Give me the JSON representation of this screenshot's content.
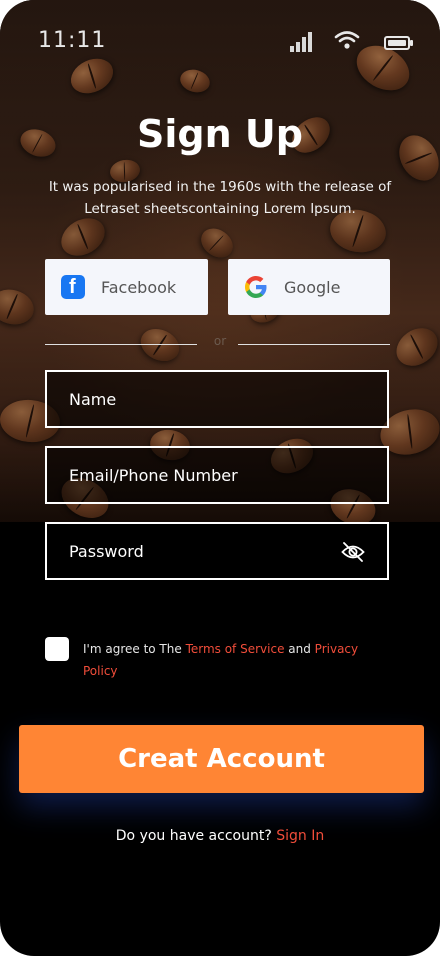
{
  "status": {
    "time": "11:11"
  },
  "header": {
    "title": "Sign Up",
    "subtitle": "It was popularised in the 1960s with the release of Letraset sheetscontaining Lorem Ipsum."
  },
  "social": {
    "facebook_label": "Facebook",
    "google_label": "Google"
  },
  "divider": {
    "text": "or"
  },
  "form": {
    "name_placeholder": "Name",
    "email_placeholder": "Email/Phone Number",
    "password_placeholder": "Password"
  },
  "terms": {
    "prefix": "I'm agree to The ",
    "terms_link": "Terms of Service",
    "middle": " and ",
    "privacy_link": "Privacy Policy"
  },
  "cta": {
    "label": "Creat Account"
  },
  "footer": {
    "question": "Do you have account? ",
    "signin_link": "Sign In"
  },
  "colors": {
    "accent": "#ff8534",
    "link": "#f04d3a",
    "facebook": "#1877f2"
  }
}
